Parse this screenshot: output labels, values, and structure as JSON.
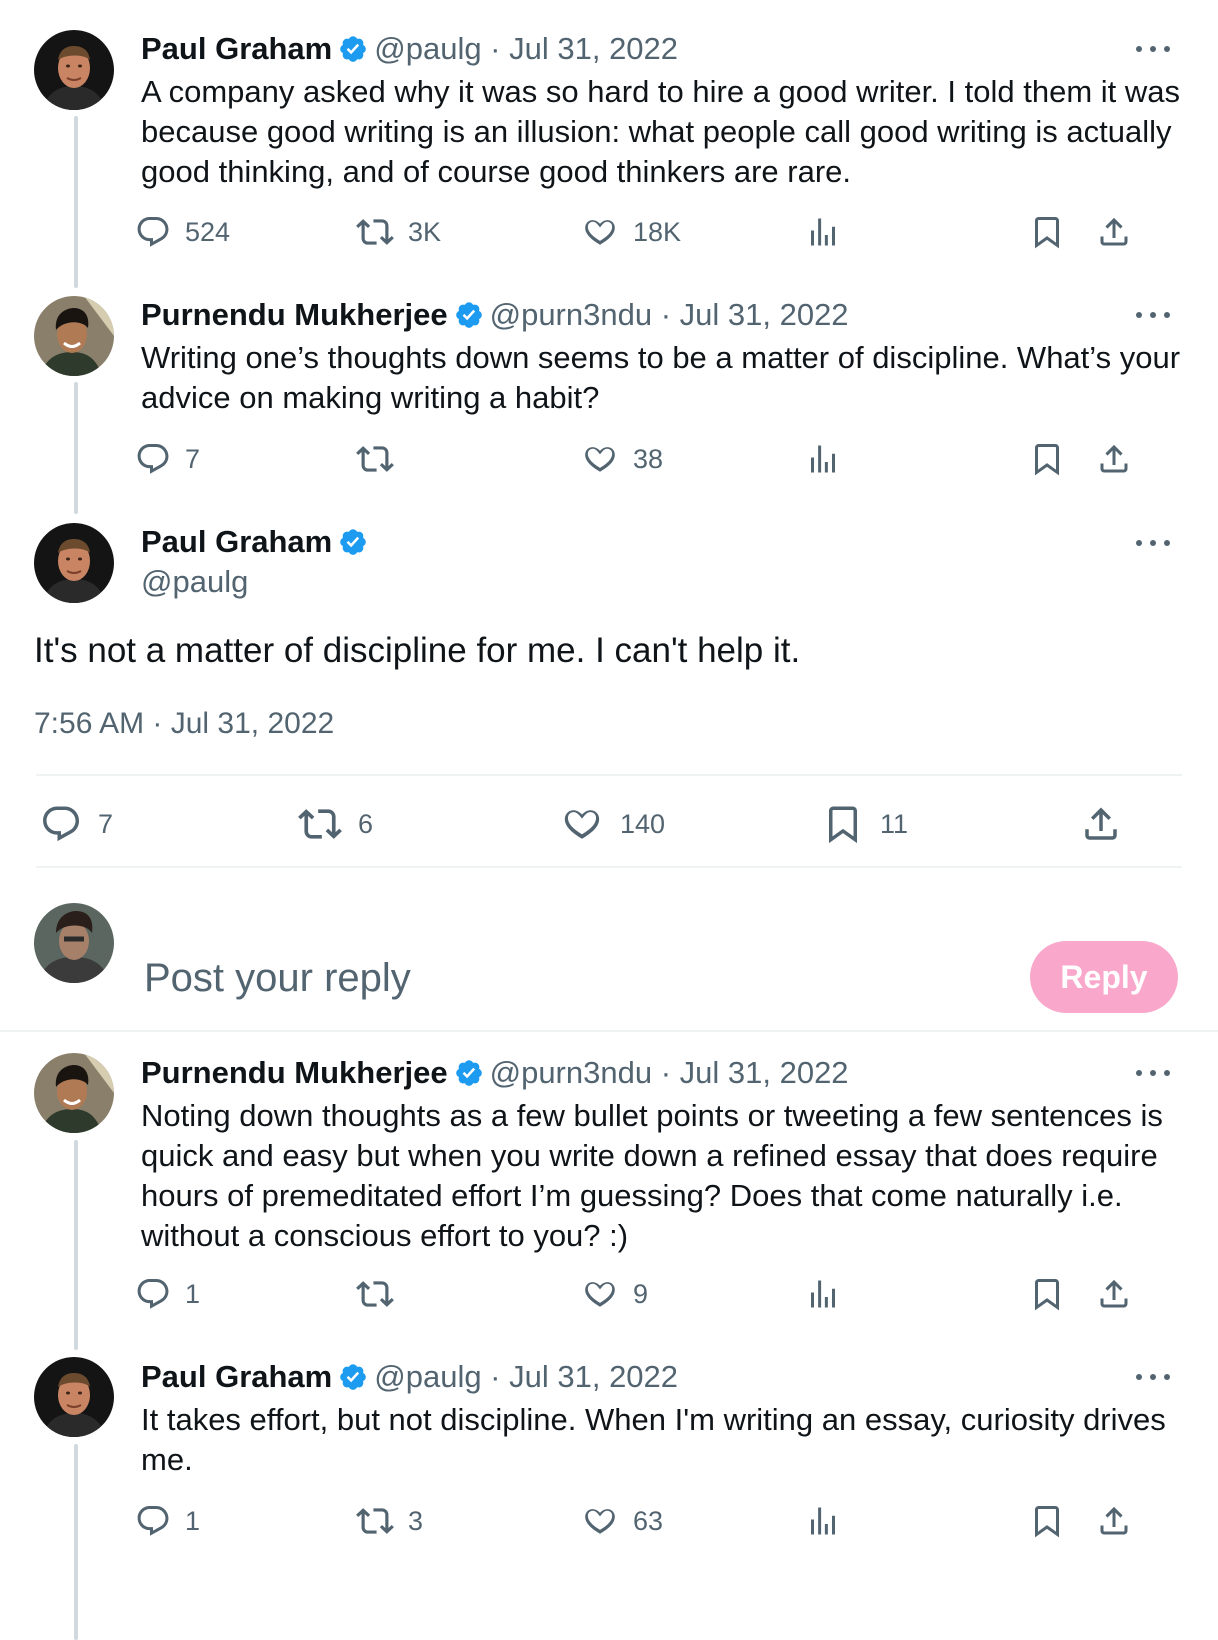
{
  "posts": [
    {
      "name": "Paul Graham",
      "meta": "@paulg · Jul 31, 2022",
      "text": "A company asked why it was so hard to hire a good writer. I told them it was because good writing is an illusion: what people call good writing is actually good thinking, and of course good thinkers are rare.",
      "replies": "524",
      "reposts": "3K",
      "likes": "18K"
    },
    {
      "name": "Purnendu Mukherjee",
      "meta": "@purn3ndu · Jul 31, 2022",
      "text": "Writing one’s thoughts down seems to be a matter of discipline. What’s your advice on making writing a habit?",
      "replies": "7",
      "reposts": "",
      "likes": "38"
    }
  ],
  "main": {
    "name": "Paul Graham",
    "handle": "@paulg",
    "text": "It's not a matter of discipline for me. I can't help it.",
    "timestamp": "7:56 AM · Jul 31, 2022",
    "replies": "7",
    "reposts": "6",
    "likes": "140",
    "bookmarks": "11"
  },
  "composer": {
    "placeholder": "Post your reply",
    "button_label": "Reply"
  },
  "replies": [
    {
      "name": "Purnendu Mukherjee",
      "meta": "@purn3ndu · Jul 31, 2022",
      "text": "Noting down thoughts as a few bullet points or tweeting a few sentences is quick and easy but when you write down a refined essay that does require hours of premeditated effort I’m guessing? Does that come naturally i.e. without a conscious effort to you? :)",
      "replies": "1",
      "reposts": "",
      "likes": "9"
    },
    {
      "name": "Paul Graham",
      "meta": "@paulg · Jul 31, 2022",
      "text": "It takes effort, but not discipline. When I'm writing an essay, curiosity drives me.",
      "replies": "1",
      "reposts": "3",
      "likes": "63"
    }
  ],
  "colors": {
    "text": "#0f1419",
    "muted": "#536471",
    "verified": "#1d9bf0",
    "reply_button": "#f9a8cb",
    "thread_line": "#cfd9de"
  },
  "icons": [
    "reply-icon",
    "repost-icon",
    "like-icon",
    "views-icon",
    "bookmark-icon",
    "share-icon",
    "verified-badge-icon",
    "more-icon"
  ]
}
